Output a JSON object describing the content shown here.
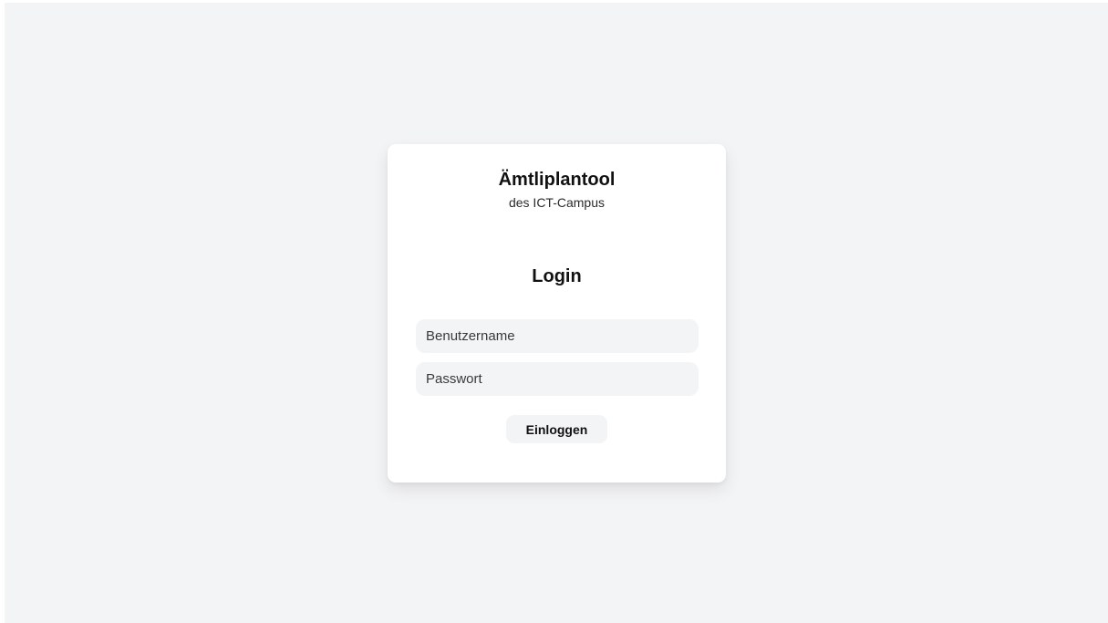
{
  "app": {
    "title": "Ämtliplantool",
    "subtitle": "des ICT-Campus"
  },
  "login": {
    "heading": "Login",
    "username_placeholder": "Benutzername",
    "password_placeholder": "Passwort",
    "submit_label": "Einloggen"
  },
  "colors": {
    "background": "#f3f4f6",
    "card": "#ffffff",
    "input_background": "#f3f4f6",
    "text": "#111111"
  }
}
